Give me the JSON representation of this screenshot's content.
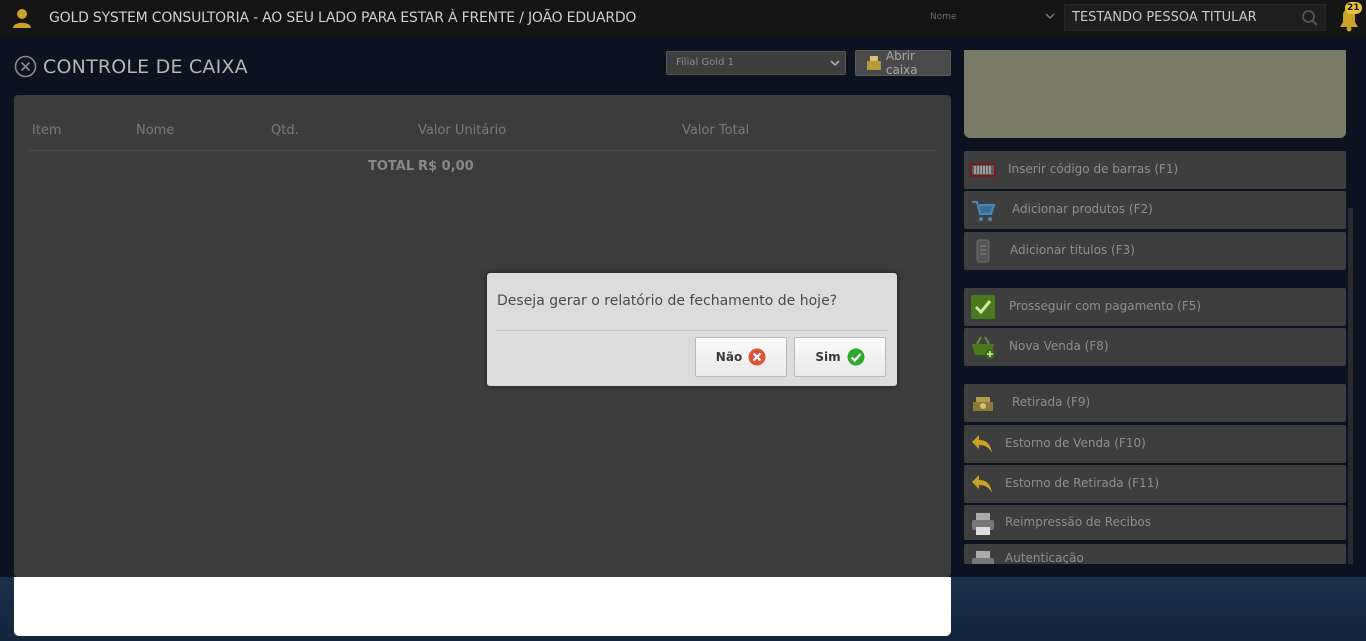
{
  "topbar": {
    "title": "GOLD SYSTEM CONSULTORIA - AO SEU LADO PARA ESTAR À FRENTE / JOÃO EDUARDO",
    "name_select": "Nome",
    "search_value": "TESTANDO PESSOA TITULAR",
    "notification_count": "21"
  },
  "page": {
    "heading": "CONTROLE DE CAIXA",
    "filial_selected": "Filial Gold 1",
    "open_cash_label": "Abrir caixa"
  },
  "table": {
    "headers": [
      "Item",
      "Nome",
      "Qtd.",
      "Valor Unitário",
      "Valor Total"
    ],
    "total_label": "TOTAL",
    "total_value": "R$ 0,00"
  },
  "sidebar": {
    "buttons": [
      {
        "label": "Inserir código de barras (F1)",
        "icon": "barcode-icon"
      },
      {
        "label": "Adicionar produtos (F2)",
        "icon": "cart-add-icon"
      },
      {
        "label": "Adicionar títulos (F3)",
        "icon": "document-icon"
      },
      {
        "label": "Prosseguir com pagamento (F5)",
        "icon": "checkmark-icon"
      },
      {
        "label": "Nova Venda (F8)",
        "icon": "basket-plus-icon"
      },
      {
        "label": "Retirada (F9)",
        "icon": "cash-withdraw-icon"
      },
      {
        "label": "Estorno de Venda (F10)",
        "icon": "undo-arrow-icon"
      },
      {
        "label": "Estorno de Retirada (F11)",
        "icon": "undo-arrow-icon"
      },
      {
        "label": "Reimpressão de Recibos",
        "icon": "printer-icon"
      },
      {
        "label": "Autenticação",
        "icon": "printer-icon"
      }
    ]
  },
  "dialog": {
    "message": "Deseja gerar o relatório de fechamento de hoje?",
    "no_label": "Não",
    "yes_label": "Sim"
  },
  "colors": {
    "accent_yes": "#2fa82f",
    "accent_no": "#e0523a",
    "topbar_bg": "#141414"
  }
}
